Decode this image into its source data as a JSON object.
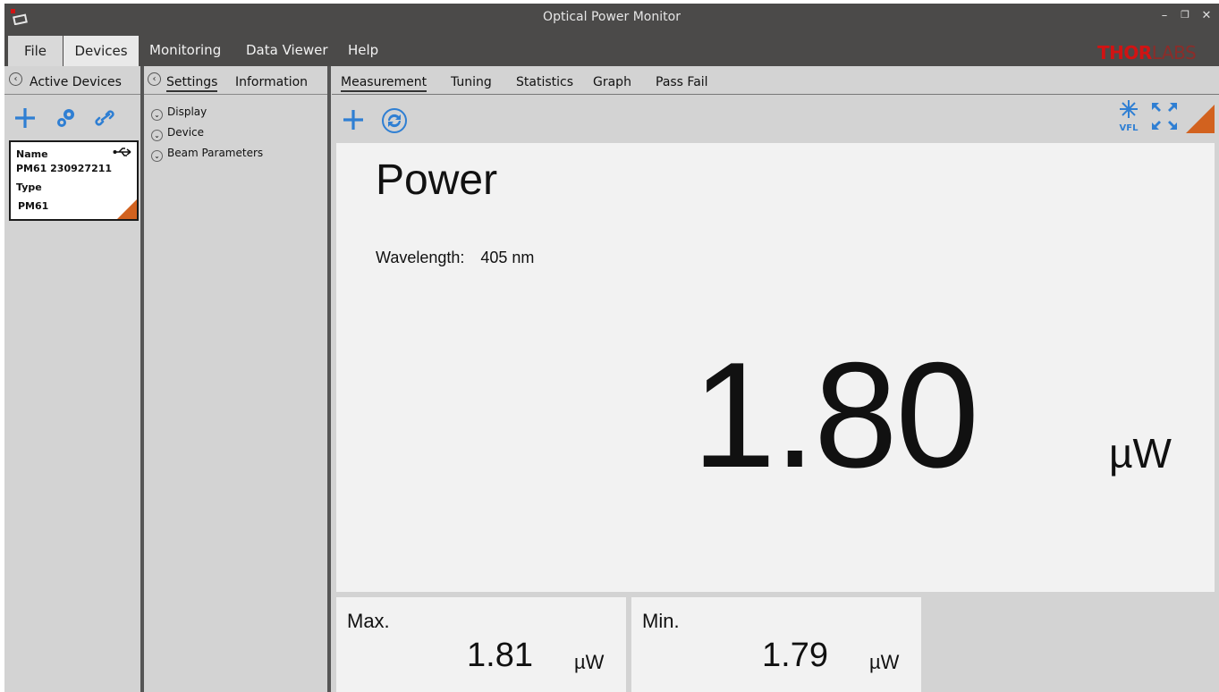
{
  "window": {
    "title": "Optical Power Monitor",
    "app_icon": "thorlabs-app-icon",
    "controls": [
      "minimize-icon",
      "restore-icon",
      "close-icon"
    ]
  },
  "menu": {
    "items": [
      "File",
      "Devices",
      "Monitoring",
      "Data Viewer",
      "Help"
    ],
    "active": "Devices"
  },
  "logo": {
    "text_bold": "THOR",
    "text_light": "LABS",
    "color": "#d11313"
  },
  "left_panel": {
    "header": "Active Devices",
    "tools": [
      "add-icon",
      "settings-gears-icon",
      "link-icon"
    ],
    "device_card": {
      "name_label": "Name",
      "name_value": "PM61 230927211",
      "type_label": "Type",
      "type_value": "PM61",
      "connection_icon": "usb-icon"
    }
  },
  "middle_panel": {
    "tabs": [
      "Settings",
      "Information"
    ],
    "active_tab": "Settings",
    "tree": [
      "Display",
      "Device",
      "Beam Parameters"
    ]
  },
  "main": {
    "tabs": [
      "Measurement",
      "Tuning",
      "Statistics",
      "Graph",
      "Pass Fail"
    ],
    "active_tab": "Measurement",
    "toolbar": [
      "add-icon",
      "refresh-icon"
    ],
    "right_tools": {
      "vfl_label": "VFL",
      "icons": [
        "vfl-icon",
        "fullscreen-icon"
      ]
    },
    "title": "Power",
    "wavelength_label": "Wavelength:",
    "wavelength_value": "405 nm",
    "reading": "1.80",
    "unit": "µW",
    "max": {
      "label": "Max.",
      "value": "1.81",
      "unit": "µW"
    },
    "min": {
      "label": "Min.",
      "value": "1.79",
      "unit": "µW"
    }
  },
  "colors": {
    "accent_blue": "#2f7fd3",
    "accent_orange": "#d2621f",
    "titlebar": "#4b4a49",
    "panel_bg": "#d3d3d3",
    "display_bg": "#f2f2f2"
  }
}
